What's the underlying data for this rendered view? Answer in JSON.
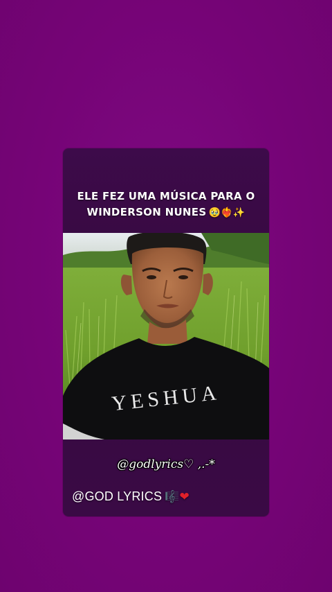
{
  "story": {
    "caption_line1": "ELE FEZ UMA MÚSICA PARA O",
    "caption_line2": "WINDERSON NUNES",
    "caption_emojis": "🥹❤️‍🔥✨",
    "video": {
      "shirt_text": "YESHUA"
    },
    "handle_text": "@godlyrics♡ ,.-*",
    "brand_text": "@GOD LYRICS",
    "brand_icons": {
      "music": "🎼",
      "heart": "❤"
    }
  },
  "colors": {
    "background": "#78047a",
    "card": "#3a0a45",
    "text": "#ffffff"
  }
}
